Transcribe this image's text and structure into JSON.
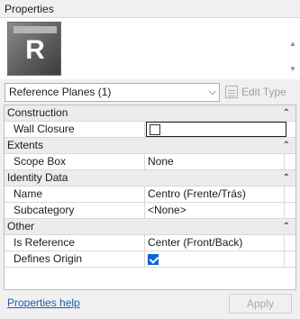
{
  "title": "Properties",
  "preview": {
    "logo_letter": "R"
  },
  "type_selector": {
    "selected": "Reference Planes (1)",
    "edit_type_label": "Edit Type"
  },
  "sections": [
    {
      "name": "Construction",
      "rows": [
        {
          "name": "Wall Closure",
          "value": "",
          "kind": "checkbox",
          "checked": false
        }
      ]
    },
    {
      "name": "Extents",
      "rows": [
        {
          "name": "Scope Box",
          "value": "None",
          "kind": "text"
        }
      ]
    },
    {
      "name": "Identity Data",
      "rows": [
        {
          "name": "Name",
          "value": "Centro (Frente/Trás)",
          "kind": "text"
        },
        {
          "name": "Subcategory",
          "value": "<None>",
          "kind": "text"
        }
      ]
    },
    {
      "name": "Other",
      "rows": [
        {
          "name": "Is Reference",
          "value": "Center (Front/Back)",
          "kind": "text"
        },
        {
          "name": "Defines Origin",
          "value": "",
          "kind": "checkbox",
          "checked": true
        }
      ]
    }
  ],
  "footer": {
    "help_link": "Properties help",
    "apply_label": "Apply"
  },
  "colors": {
    "checkbox_checked": "#0a64d8",
    "link": "#1a5fb4"
  }
}
